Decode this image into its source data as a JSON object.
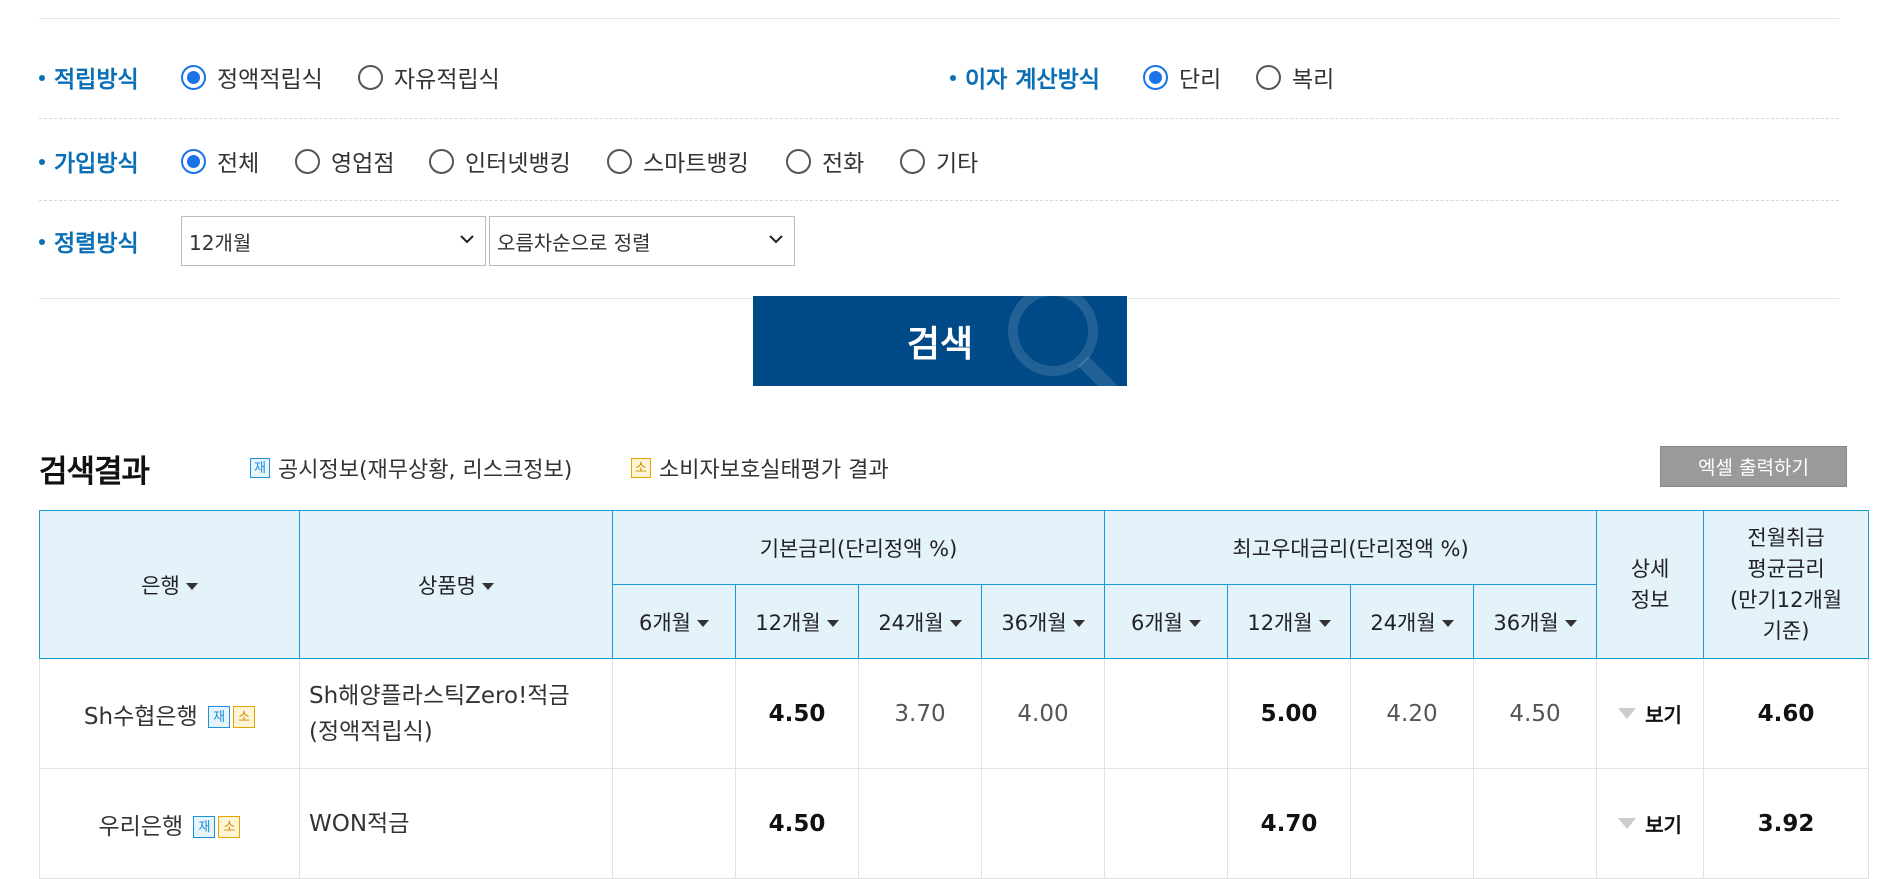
{
  "filters": {
    "saving_method": {
      "label": "적립방식",
      "options": [
        "정액적립식",
        "자유적립식"
      ],
      "selected": "정액적립식"
    },
    "interest_method": {
      "label": "이자 계산방식",
      "options": [
        "단리",
        "복리"
      ],
      "selected": "단리"
    },
    "join_method": {
      "label": "가입방식",
      "options": [
        "전체",
        "영업점",
        "인터넷뱅킹",
        "스마트뱅킹",
        "전화",
        "기타"
      ],
      "selected": "전체"
    },
    "sort_method": {
      "label": "정렬방식",
      "period_value": "12개월",
      "order_value": "오름차순으로 정렬"
    }
  },
  "search_button": "검색",
  "results": {
    "title": "검색결과",
    "legend_jae_badge": "재",
    "legend_jae_text": "공시정보(재무상황, 리스크정보)",
    "legend_so_badge": "소",
    "legend_so_text": "소비자보호실태평가 결과",
    "excel_button": "엑셀 출력하기"
  },
  "table": {
    "header_bank": "은행",
    "header_product": "상품명",
    "header_base": "기본금리(단리정액 %)",
    "header_max": "최고우대금리(단리정액 %)",
    "header_detail_line1": "상세",
    "header_detail_line2": "정보",
    "header_avg_line1": "전월취급",
    "header_avg_line2": "평균금리",
    "header_avg_line3": "(만기12개월",
    "header_avg_line4": "기준)",
    "periods": [
      "6개월",
      "12개월",
      "24개월",
      "36개월"
    ],
    "view_label": "보기",
    "badge_jae": "재",
    "badge_so": "소",
    "rows": [
      {
        "bank": "Sh수협은행",
        "product_line1": "Sh해양플라스틱Zero!적금",
        "product_line2": "(정액적립식)",
        "base": [
          "",
          "4.50",
          "3.70",
          "4.00"
        ],
        "max": [
          "",
          "5.00",
          "4.20",
          "4.50"
        ],
        "avg": "4.60"
      },
      {
        "bank": "우리은행",
        "product_line1": "WON적금",
        "product_line2": "",
        "base": [
          "",
          "4.50",
          "",
          ""
        ],
        "max": [
          "",
          "4.70",
          "",
          ""
        ],
        "avg": "3.92"
      }
    ]
  }
}
